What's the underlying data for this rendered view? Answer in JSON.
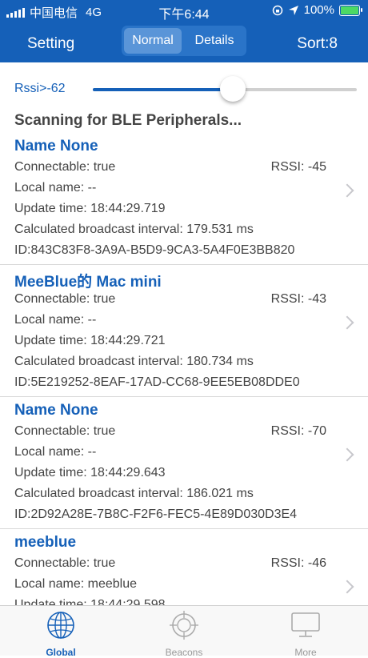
{
  "status_bar": {
    "carrier": "中国电信",
    "network": "4G",
    "time": "下午6:44",
    "battery": "100%"
  },
  "nav": {
    "left": "Setting",
    "segments": [
      "Normal",
      "Details"
    ],
    "right": "Sort:8"
  },
  "filter": {
    "label": "Rssi>-62",
    "level_percent": 53
  },
  "scan_title": "Scanning for BLE Peripherals...",
  "devices": [
    {
      "name": "Name None",
      "connectable": "Connectable: true",
      "rssi": "RSSI: -45",
      "local": "Local name: --",
      "update": "Update time: 18:44:29.719",
      "interval": "Calculated broadcast interval: 179.531 ms",
      "id": "ID:843C83F8-3A9A-B5D9-9CA3-5A4F0E3BB820"
    },
    {
      "name": "MeeBlue的 Mac mini",
      "connectable": "Connectable: true",
      "rssi": "RSSI: -43",
      "local": "Local name: --",
      "update": "Update time: 18:44:29.721",
      "interval": "Calculated broadcast interval: 180.734 ms",
      "id": "ID:5E219252-8EAF-17AD-CC68-9EE5EB08DDE0"
    },
    {
      "name": "Name None",
      "connectable": "Connectable: true",
      "rssi": "RSSI: -70",
      "local": "Local name: --",
      "update": "Update time: 18:44:29.643",
      "interval": "Calculated broadcast interval: 186.021 ms",
      "id": "ID:2D92A28E-7B8C-F2F6-FEC5-4E89D030D3E4"
    },
    {
      "name": "meeblue",
      "connectable": "Connectable: true",
      "rssi": "RSSI: -46",
      "local": "Local name: meeblue",
      "update": "Update time: 18:44:29.598",
      "interval": "",
      "id": ""
    }
  ],
  "tabs": [
    {
      "label": "Global",
      "icon": "globe-icon"
    },
    {
      "label": "Beacons",
      "icon": "target-icon"
    },
    {
      "label": "More",
      "icon": "monitor-icon"
    }
  ],
  "colors": {
    "primary": "#1560b8",
    "battery": "#4cd964"
  }
}
